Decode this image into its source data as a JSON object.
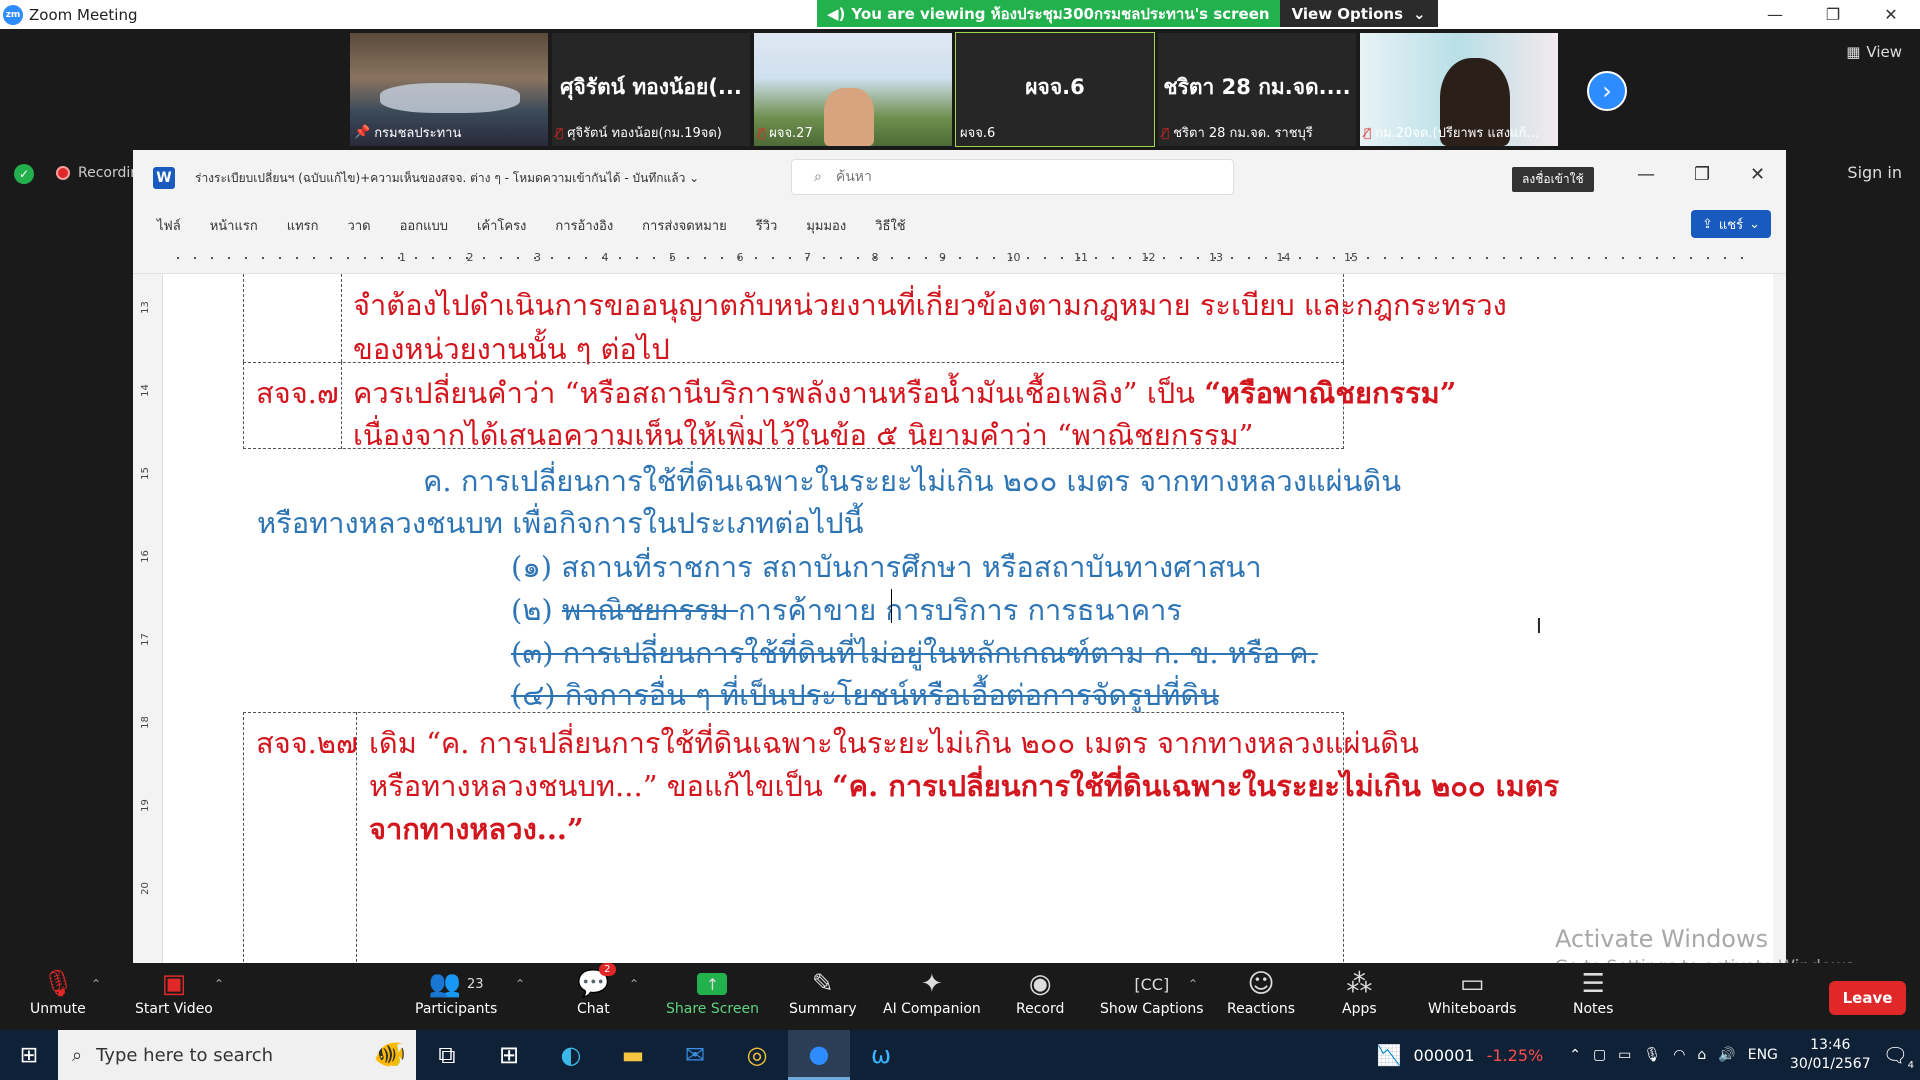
{
  "window": {
    "title": "Zoom Meeting",
    "controls": [
      "—",
      "❐",
      "✕"
    ]
  },
  "banner": {
    "message": "You are viewing ห้องประชุม300กรมชลประทาน's screen",
    "options_label": "View Options"
  },
  "thumbnails": [
    {
      "caption": "กรมชลประทาน",
      "kind": "photo"
    },
    {
      "big_name": "ศุจิรัตน์ ทองน้อย(...",
      "caption": "ศุจิรัตน์ ทองน้อย(กม.19จด)",
      "kind": "name"
    },
    {
      "caption": "ผจจ.27",
      "kind": "photo"
    },
    {
      "big_name": "ผจจ.6",
      "caption": "ผจจ.6",
      "kind": "name",
      "active": true
    },
    {
      "big_name": "ชริตา 28 กม.จด....",
      "caption": "ชริตา 28 กม.จด. ราชบุรี",
      "kind": "name"
    },
    {
      "caption": "กม.20จด.(ปรียาพร แสงแก้...",
      "kind": "photo"
    }
  ],
  "view_label": "View",
  "recording_label": "Recordin",
  "sign_in_label": "Sign in",
  "word": {
    "doc_name": "ร่างระเบียบเปลี่ยนฯ (ฉบับแก้ไข)+ความเห็นของสจจ. ต่าง ๆ  -  โหมดความเข้ากันได้  -  บันทึกแล้ว ⌄",
    "search_placeholder": "ค้นหา",
    "signin_button": "ลงชื่อเข้าใช้",
    "menu": [
      "ไฟล์",
      "หน้าแรก",
      "แทรก",
      "วาด",
      "ออกแบบ",
      "เค้าโครง",
      "การอ้างอิง",
      "การส่งจดหมาย",
      "รีวิว",
      "มุมมอง",
      "วิธีใช้"
    ],
    "share_label": "แชร์",
    "ruler_numbers": [
      "1",
      "2",
      "3",
      "4",
      "5",
      "6",
      "7",
      "8",
      "9",
      "10",
      "11",
      "12",
      "13",
      "14",
      "15"
    ],
    "vruler_numbers": [
      "13",
      "14",
      "15",
      "16",
      "17",
      "18",
      "19",
      "20"
    ],
    "content": {
      "line1": "จำต้องไปดำเนินการขออนุญาตกับหน่วยงานที่เกี่ยวข้องตามกฎหมาย ระเบียบ และกฎกระทรวง",
      "line2": "ของหน่วยงานนั้น ๆ ต่อไป",
      "row2_label": "สจจ.๗",
      "row2_line1_a": "ควรเปลี่ยนคำว่า “หรือสถานีบริการพลังงานหรือน้ำมันเชื้อเพลิง” เป็น ",
      "row2_line1_b": "“หรือพาณิชยกรรม”",
      "row2_line2": "เนื่องจากได้เสนอความเห็นให้เพิ่มไว้ในข้อ ๕ นิยามคำว่า “พาณิชยกรรม”",
      "para_c1": "ค. การเปลี่ยนการใช้ที่ดินเฉพาะในระยะไม่เกิน ๒๐๐ เมตร จากทางหลวงแผ่นดิน",
      "para_c2": "หรือทางหลวงชนบท เพื่อกิจการในประเภทต่อไปนี้",
      "item1": "(๑) สถานที่ราชการ สถาบันการศึกษา หรือสถาบันทางศาสนา",
      "item2_prefix": "(๒) ",
      "item2_struck": "พาณิชยกรรม ",
      "item2_rest": "การค้าขาย การบริการ การธนาคาร",
      "item3": "(๓) การเปลี่ยนการใช้ที่ดินที่ไม่อยู่ในหลักเกณฑ์ตาม ก. ข. หรือ ค.",
      "item4": "(๔) กิจการอื่น ๆ ที่เป็นประโยชน์หรือเอื้อต่อการจัดรูปที่ดิน",
      "row3_label": "สจจ.๒๗",
      "row3_line1": "เดิม “ค. การเปลี่ยนการใช้ที่ดินเฉพาะในระยะไม่เกิน ๒๐๐ เมตร จากทางหลวงแผ่นดิน",
      "row3_line2_a": "หรือทางหลวงชนบท...” ขอแก้ไขเป็น ",
      "row3_line2_b": "“ค. การเปลี่ยนการใช้ที่ดินเฉพาะในระยะไม่เกิน ๒๐๐ เมตร",
      "row3_line3": "จากทางหลวง...”"
    }
  },
  "activate": {
    "title": "Activate Windows",
    "subtitle": "Go to Settings to activate Windows."
  },
  "toolbar": {
    "unmute": "Unmute",
    "start_video": "Start Video",
    "participants": "Participants",
    "participants_count": "23",
    "chat": "Chat",
    "chat_badge": "2",
    "share_screen": "Share Screen",
    "summary": "Summary",
    "ai_companion": "AI Companion",
    "record": "Record",
    "show_captions": "Show Captions",
    "reactions": "Reactions",
    "apps": "Apps",
    "whiteboards": "Whiteboards",
    "notes": "Notes",
    "leave": "Leave"
  },
  "taskbar": {
    "search_placeholder": "Type here to search",
    "stock_value": "000001",
    "stock_change": "-1.25%",
    "lang": "ENG",
    "time": "13:46",
    "date": "30/01/2567",
    "notif_count": "4"
  }
}
